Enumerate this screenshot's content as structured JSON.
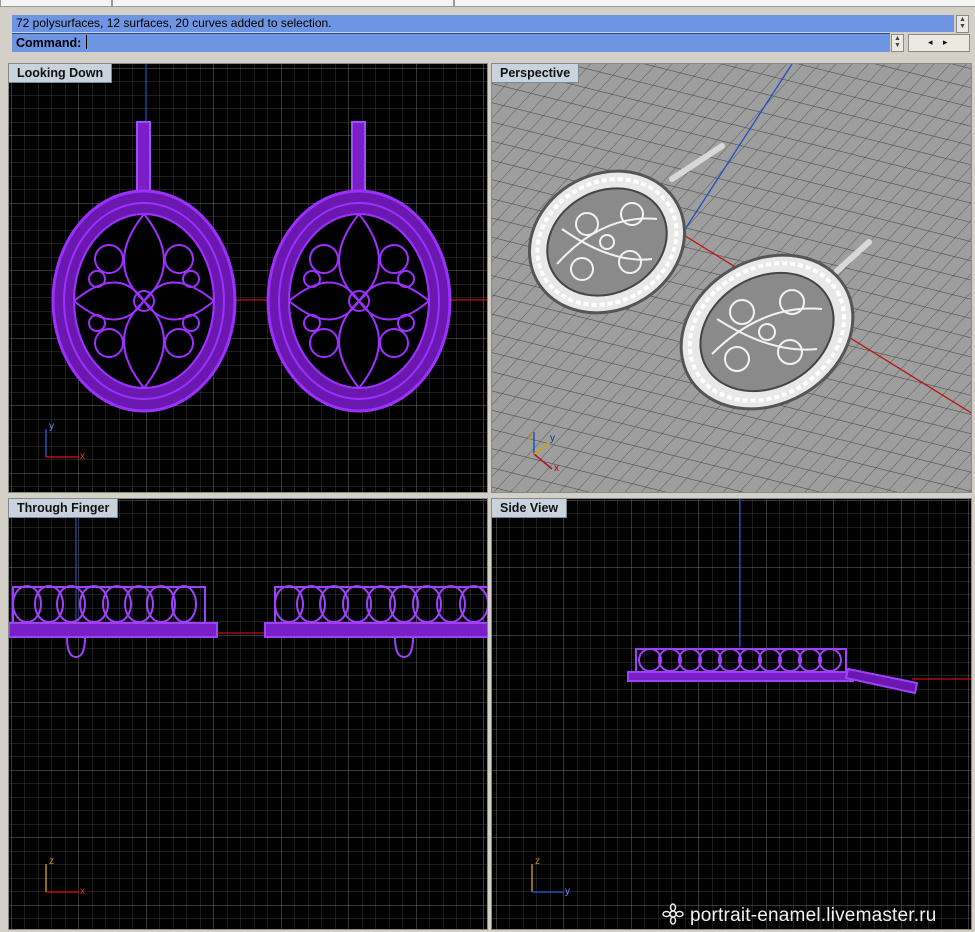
{
  "command": {
    "history": "72 polysurfaces, 12 surfaces, 20 curves added to selection.",
    "prompt": "Command:"
  },
  "viewports": {
    "top_left": {
      "title": "Looking Down",
      "axis1": "y",
      "axis2": "x"
    },
    "top_right": {
      "title": "Perspective",
      "axis1": "y",
      "axis2": "x",
      "axis3": "z"
    },
    "bottom_left": {
      "title": "Through Finger",
      "axis1": "z",
      "axis2": "x"
    },
    "bottom_right": {
      "title": "Side View",
      "axis1": "z",
      "axis2": "y"
    }
  },
  "colors": {
    "selection": "#8a2be2",
    "viewport_bg": "#000000",
    "perspective_bg": "#9e9e9e",
    "command_bar": "#6e95e2",
    "x_axis": "#c01010",
    "y_axis": "#2050c0"
  },
  "watermark": "portrait-enamel.livemaster.ru"
}
